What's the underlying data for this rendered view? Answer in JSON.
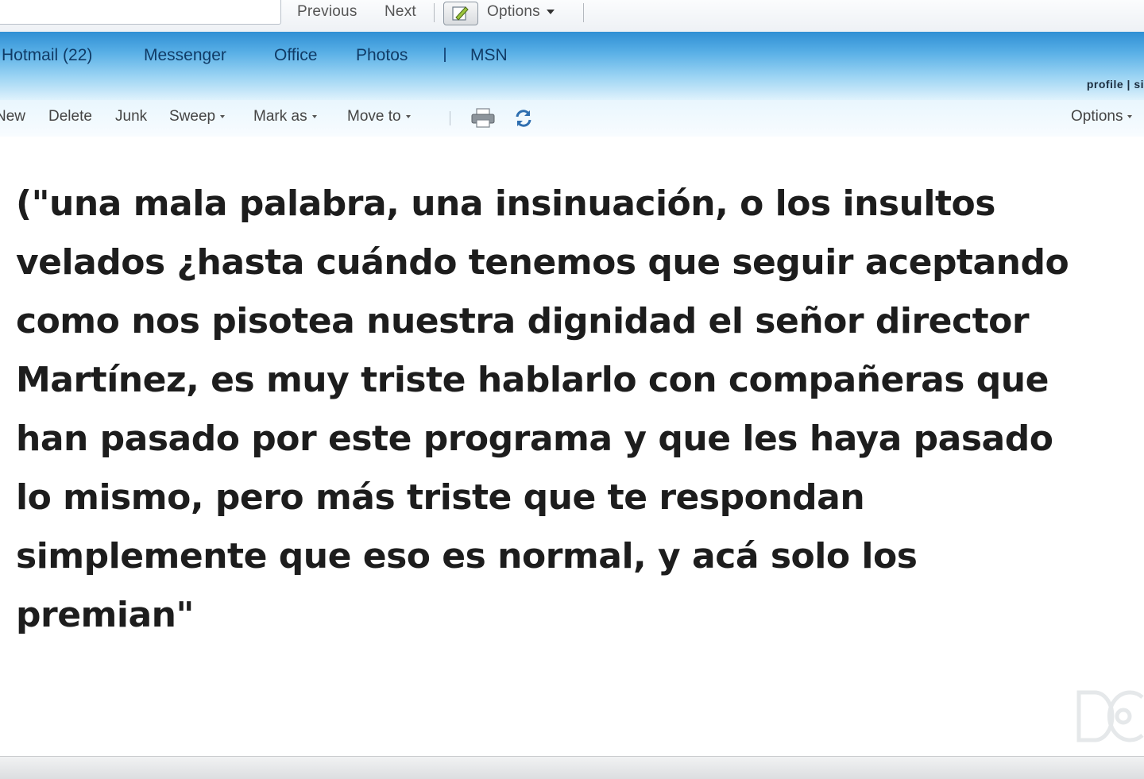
{
  "toolbar": {
    "address_value": "",
    "previous_label": "Previous",
    "next_label": "Next",
    "options_label": "Options"
  },
  "header": {
    "tabs": [
      {
        "label": "Hotmail (22)"
      },
      {
        "label": "Messenger"
      },
      {
        "label": "Office"
      },
      {
        "label": "Photos"
      },
      {
        "label": "MSN"
      }
    ],
    "profile_label": "profile | si"
  },
  "commands": {
    "new_label": "New",
    "delete_label": "Delete",
    "junk_label": "Junk",
    "sweep_label": "Sweep",
    "mark_as_label": "Mark as",
    "move_to_label": "Move to",
    "options_label": "Options",
    "icons": [
      "printer-icon",
      "refresh-icon"
    ]
  },
  "message": {
    "body": "(\"una mala palabra, una insinuación, o los insultos\nvelados ¿hasta cuándo tenemos que seguir aceptando\ncomo nos pisotea nuestra dignidad el señor director\nMartínez, es muy triste hablarlo con compañeras que\nhan pasado por este programa y que les haya pasado\nlo mismo, pero más triste que te respondan\nsimplemente que eso es normal, y acá solo los\npremian\""
  },
  "colors": {
    "header_top": "#2f8fd4",
    "header_bottom": "#dff2fc",
    "tab_text": "#103b66",
    "body_text": "#1d1d1d"
  }
}
